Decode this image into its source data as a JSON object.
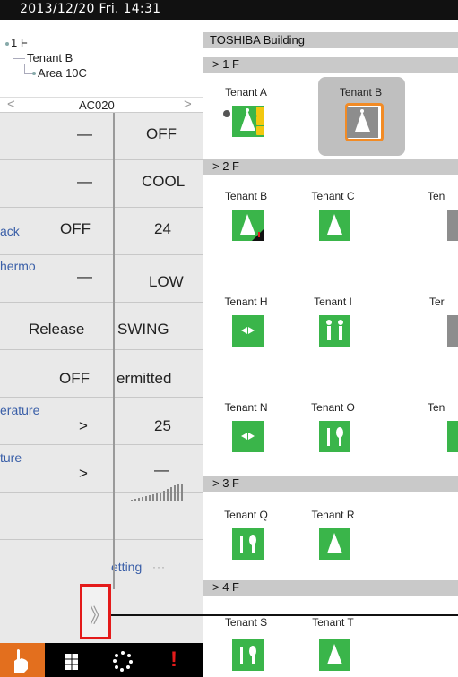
{
  "header": {
    "datetime": "2013/12/20  Fri.  14:31"
  },
  "tree": {
    "floor": "1 F",
    "tenant": "Tenant B",
    "area": "Area 10C"
  },
  "unit_selector": {
    "name": "AC020",
    "prev": "<",
    "next": ">"
  },
  "settings": {
    "rows": [
      {
        "left": "—",
        "right": "OFF"
      },
      {
        "left": "—",
        "right": "COOL"
      },
      {
        "left_label": "ack",
        "left": "OFF",
        "right": "24"
      },
      {
        "left_label": "hermo",
        "left": "—",
        "right": "LOW"
      },
      {
        "left": "Release",
        "right": "SWING"
      },
      {
        "left": "OFF",
        "right": "ermitted"
      },
      {
        "left_label": "erature",
        "left": ">",
        "right": "25"
      },
      {
        "left_label": "ture",
        "left": ">",
        "right": "—"
      },
      {
        "left": "",
        "right": ""
      },
      {
        "left": "",
        "right_link": "etting",
        "dots": "···"
      }
    ],
    "expand_glyph": "》"
  },
  "toolbar": {
    "items": [
      {
        "icon": "hand-pointer-icon"
      },
      {
        "icon": "schedule-icon"
      },
      {
        "icon": "loading-icon"
      },
      {
        "icon": "alarm-icon",
        "glyph": "!"
      }
    ]
  },
  "building": {
    "title": "TOSHIBA Building"
  },
  "floors": [
    {
      "label": "> 1 F",
      "tenants": [
        {
          "name": "Tenant A",
          "icon": "meeting-icon",
          "color": "#3ab54a"
        },
        {
          "name": "Tenant B",
          "icon": "meeting-icon",
          "color": "#8d8d8d"
        }
      ]
    },
    {
      "label": "> 2 F",
      "tenants": [
        {
          "name": "Tenant B",
          "icon": "meeting-icon",
          "color": "#3ab54a"
        },
        {
          "name": "Tenant C",
          "icon": "meeting-icon",
          "color": "#3ab54a"
        },
        {
          "name": "Ten",
          "icon": "meeting-icon",
          "color": "#8d8d8d"
        },
        {
          "name": "Tenant H",
          "icon": "ceiling-ac-icon",
          "color": "#3ab54a"
        },
        {
          "name": "Tenant I",
          "icon": "people-icon",
          "color": "#3ab54a"
        },
        {
          "name": "Ter",
          "icon": "fork-icon",
          "color": "#8d8d8d"
        },
        {
          "name": "Tenant N",
          "icon": "ceiling-ac-icon",
          "color": "#3ab54a"
        },
        {
          "name": "Tenant O",
          "icon": "restaurant-icon",
          "color": "#3ab54a"
        },
        {
          "name": "Ten",
          "icon": "ceiling-ac-icon",
          "color": "#3ab54a"
        }
      ]
    },
    {
      "label": "> 3 F",
      "tenants": [
        {
          "name": "Tenant Q",
          "icon": "restaurant-icon",
          "color": "#3ab54a"
        },
        {
          "name": "Tenant R",
          "icon": "meeting-icon",
          "color": "#3ab54a"
        }
      ]
    },
    {
      "label": "> 4 F",
      "tenants": [
        {
          "name": "Tenant S",
          "icon": "restaurant-icon",
          "color": "#3ab54a"
        },
        {
          "name": "Tenant T",
          "icon": "meeting-icon",
          "color": "#3ab54a"
        }
      ]
    }
  ]
}
